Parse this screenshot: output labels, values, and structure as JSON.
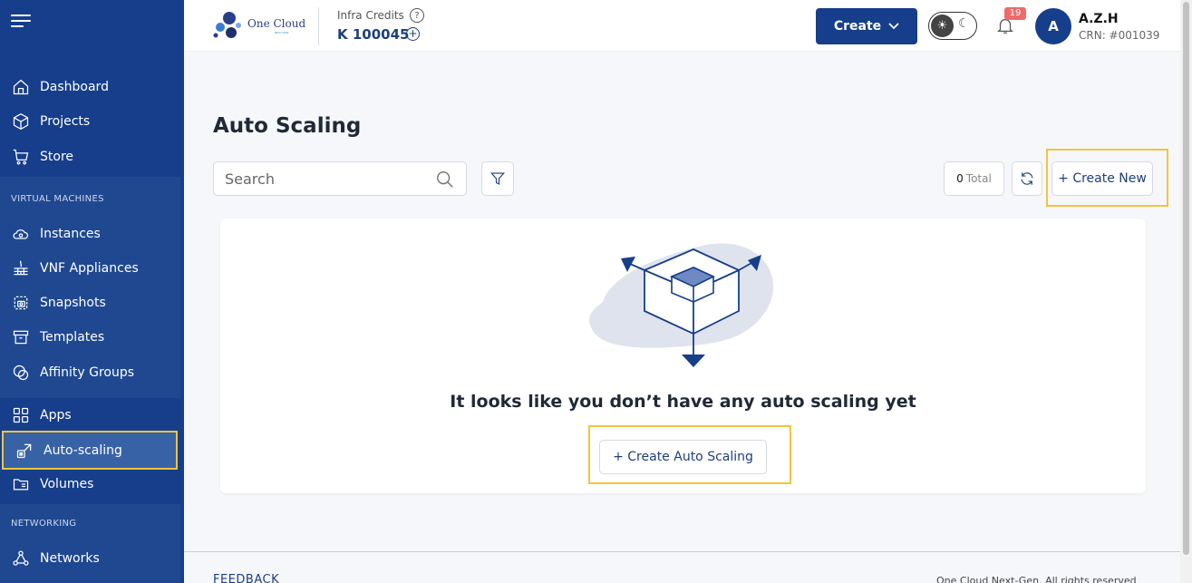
{
  "sidebar": {
    "items_top": [
      {
        "label": "Dashboard",
        "icon": "home-icon"
      },
      {
        "label": "Projects",
        "icon": "cube-icon"
      },
      {
        "label": "Store",
        "icon": "cart-icon"
      }
    ],
    "section_vm": "VIRTUAL MACHINES",
    "items_vm": [
      {
        "label": "Instances",
        "icon": "cloud-icon"
      },
      {
        "label": "VNF Appliances",
        "icon": "firewall-icon"
      },
      {
        "label": "Snapshots",
        "icon": "snapshot-icon"
      },
      {
        "label": "Templates",
        "icon": "archive-icon"
      },
      {
        "label": "Affinity Groups",
        "icon": "circles-icon"
      }
    ],
    "items_storage": [
      {
        "label": "Apps",
        "icon": "grid-icon"
      },
      {
        "label": "Auto-scaling",
        "icon": "scale-icon",
        "active": true
      },
      {
        "label": "Volumes",
        "icon": "folder-icon"
      }
    ],
    "section_net": "NETWORKING",
    "items_net": [
      {
        "label": "Networks",
        "icon": "network-icon"
      }
    ]
  },
  "header": {
    "logo_text": "One Cloud",
    "logo_sub": "NEXT-GEN",
    "credits_label": "Infra Credits",
    "credits_value": "K 100045",
    "create_label": "Create",
    "notifications": "19",
    "avatar_letter": "A",
    "user_name": "A.Z.H",
    "user_crn": "CRN: #001039"
  },
  "main": {
    "title": "Auto Scaling",
    "search_placeholder": "Search",
    "total_count": "0",
    "total_label": "Total",
    "create_new": "+ Create New",
    "empty_message": "It looks like you don’t have any auto scaling yet",
    "create_auto_scaling": "+ Create Auto Scaling"
  },
  "footer": {
    "left": "FEEDBACK",
    "right": "One Cloud Next-Gen. All rights reserved"
  },
  "colors": {
    "sidebar_bg": "#163e8a",
    "accent": "#1e3f7e",
    "highlight": "#f3c43c",
    "badge": "#f06a6a"
  }
}
